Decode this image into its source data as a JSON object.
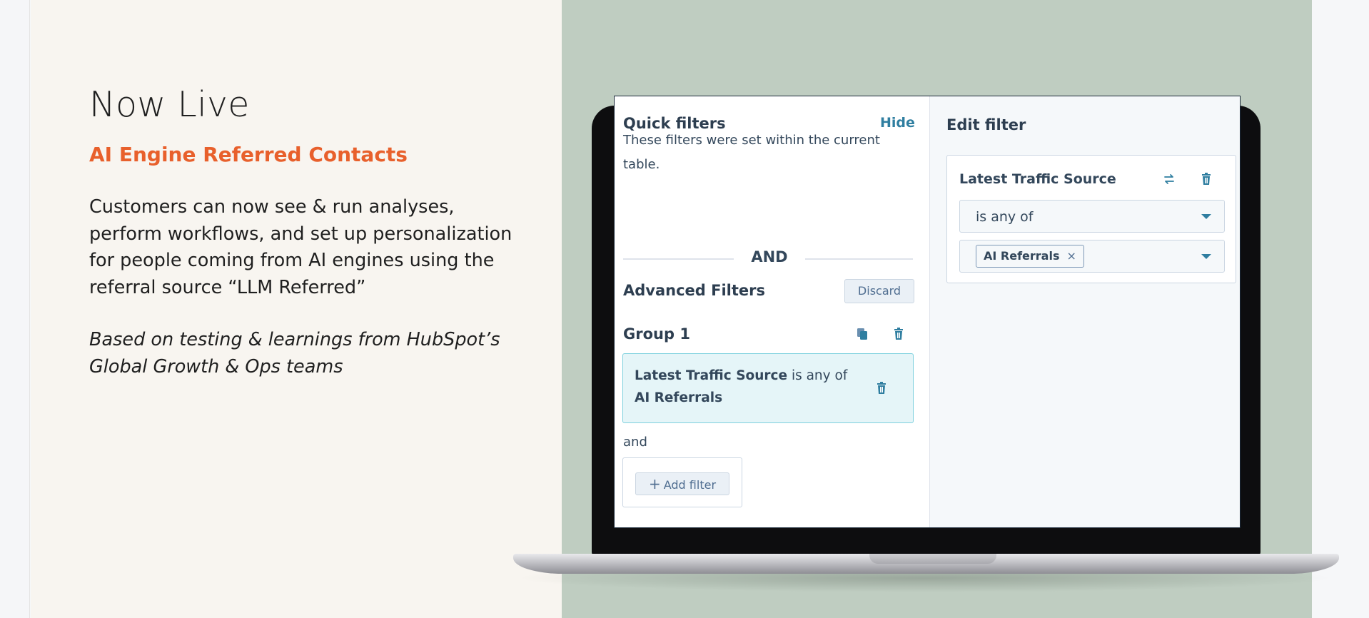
{
  "slide": {
    "headline": "Now Live",
    "subhead": "AI Engine Referred Contacts",
    "body": "Customers can now see & run analyses, perform workflows, and set up personalization for people coming from AI engines using the referral source “LLM Referred”",
    "note": "Based on testing & learnings from HubSpot’s Global Growth & Ops teams"
  },
  "colors": {
    "accent": "#e8602c",
    "green_panel": "#bfcdc1",
    "link": "#2f7ea0"
  },
  "quick_filters": {
    "title": "Quick filters",
    "hide_label": "Hide",
    "description": "These filters were set within the current table."
  },
  "divider_label": "AND",
  "advanced_filters": {
    "title": "Advanced Filters",
    "discard_label": "Discard",
    "group_title": "Group 1",
    "filter_property": "Latest Traffic Source",
    "filter_operator": "is any of",
    "filter_value": "AI Referrals",
    "and_label": "and",
    "add_filter_label": "Add filter"
  },
  "edit_filter": {
    "title": "Edit filter",
    "property": "Latest Traffic Source",
    "operator": "is any of",
    "tag_value": "AI Referrals",
    "tag_remove": "×"
  },
  "icons": [
    "swap-icon",
    "trash-icon",
    "copy-icon",
    "plus-icon",
    "caret-down-icon",
    "close-icon"
  ]
}
